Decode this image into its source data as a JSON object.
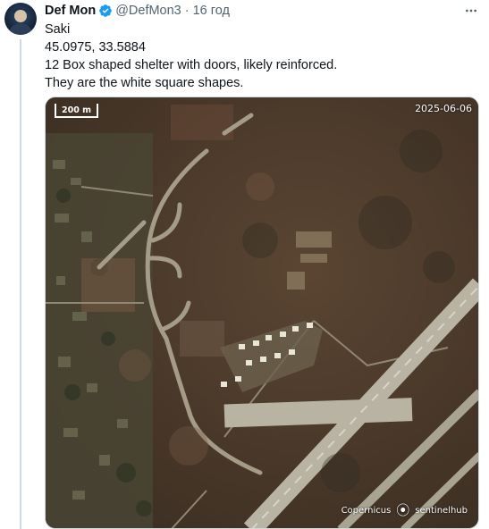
{
  "post": {
    "author_name": "Def Mon",
    "handle": "@DefMon3",
    "separator": "·",
    "time": "16 год",
    "lines": [
      "Saki",
      "45.0975, 33.5884",
      "12 Box shaped shelter with doors, likely reinforced.",
      "They are the white square shapes."
    ]
  },
  "image": {
    "scale_label": "200 m",
    "date_label": "2025-06-06",
    "credit_left": "Copernicus",
    "credit_right": "sentinelhub"
  },
  "icons": {
    "verified": "verified-badge-icon",
    "more": "more-options-icon"
  },
  "colors": {
    "verified": "#1d9bf0",
    "secondary_text": "#536471",
    "primary_text": "#0f1419"
  }
}
